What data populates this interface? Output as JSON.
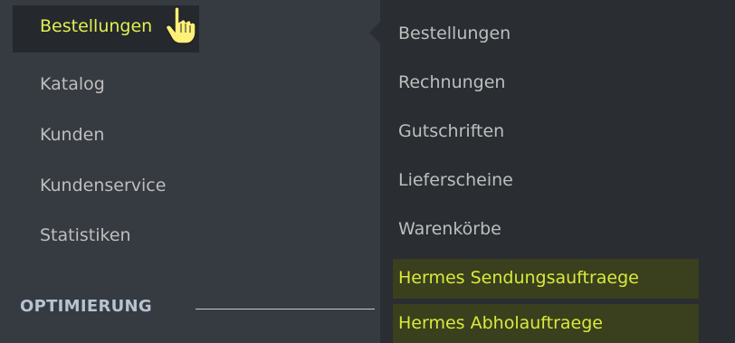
{
  "sidebar": {
    "items": [
      {
        "label": "Bestellungen"
      },
      {
        "label": "Katalog"
      },
      {
        "label": "Kunden"
      },
      {
        "label": "Kundenservice"
      },
      {
        "label": "Statistiken"
      }
    ],
    "section": {
      "label": "OPTIMIERUNG"
    }
  },
  "submenu": {
    "items": [
      {
        "label": "Bestellungen"
      },
      {
        "label": "Rechnungen"
      },
      {
        "label": "Gutschriften"
      },
      {
        "label": "Lieferscheine"
      },
      {
        "label": "Warenkörbe"
      },
      {
        "label": "Hermes Sendungsauftraege"
      },
      {
        "label": "Hermes Abholauftraege"
      }
    ]
  },
  "colors": {
    "sidebar_bg": "#363a41",
    "submenu_bg": "#2a2d32",
    "active_text": "#e0f050",
    "highlight_bg": "#3a3f1d",
    "text": "#bebebe"
  },
  "icons": {
    "cursor": "hand-pointer-icon"
  }
}
